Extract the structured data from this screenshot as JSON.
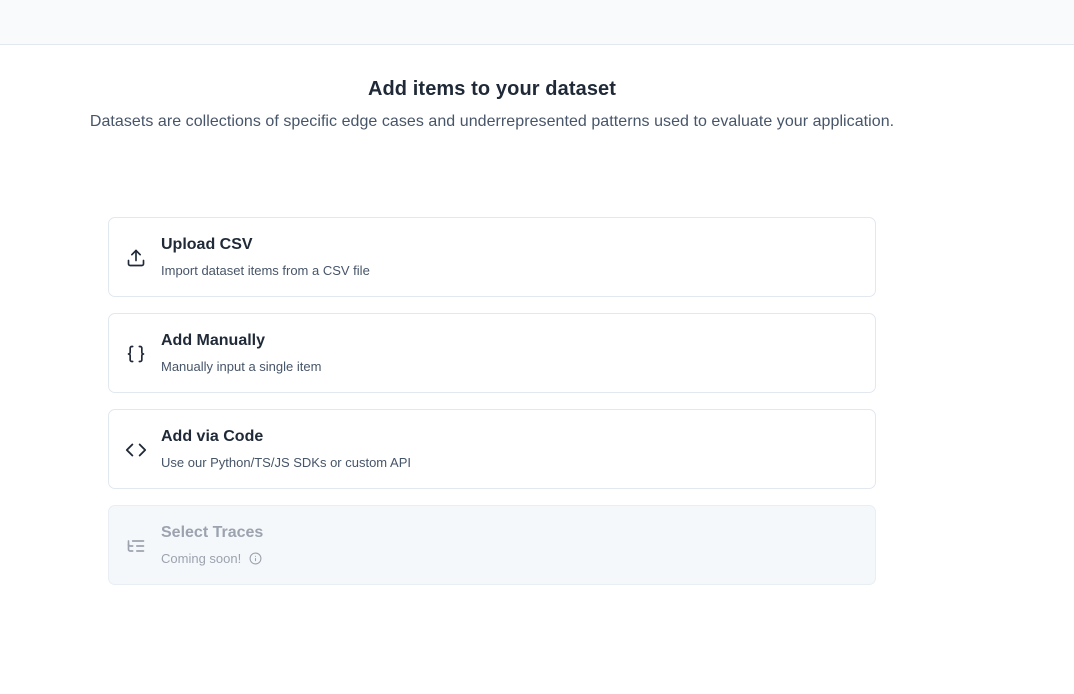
{
  "header": {
    "title": "Add items to your dataset",
    "subtitle": "Datasets are collections of specific edge cases and underrepresented patterns used to evaluate your application."
  },
  "options": [
    {
      "label": "Upload CSV",
      "description": "Import dataset items from a CSV file",
      "icon": "upload-icon",
      "enabled": true
    },
    {
      "label": "Add Manually",
      "description": "Manually input a single item",
      "icon": "braces-icon",
      "enabled": true
    },
    {
      "label": "Add via Code",
      "description": "Use our Python/TS/JS SDKs or custom API",
      "icon": "code-icon",
      "enabled": true
    },
    {
      "label": "Select Traces",
      "description": "Coming soon!",
      "icon": "list-tree-icon",
      "enabled": false,
      "info_icon": "info-icon"
    }
  ]
}
